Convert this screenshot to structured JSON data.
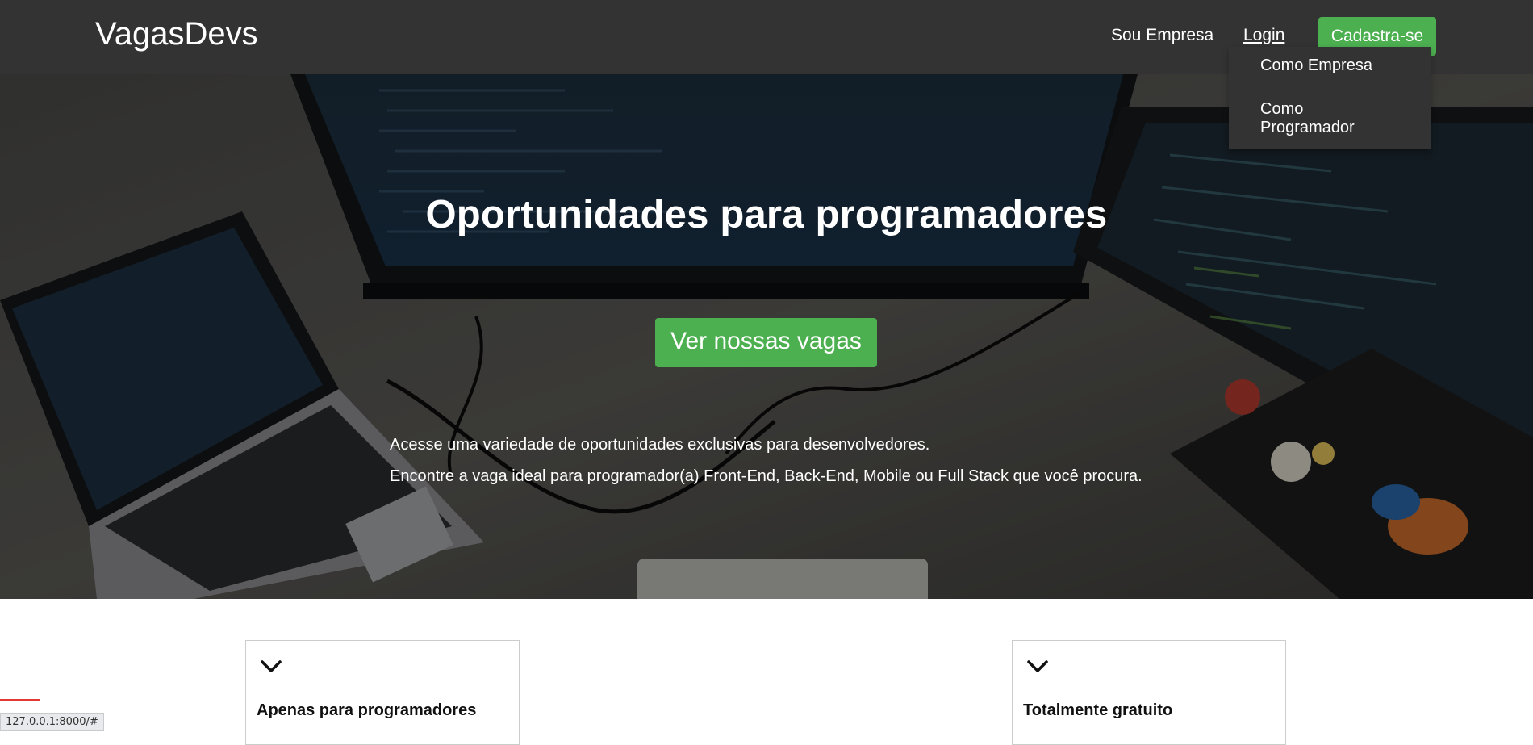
{
  "navbar": {
    "brand": "VagasDevs",
    "company_link": "Sou Empresa",
    "login_link": "Login",
    "signup_button": "Cadastra-se"
  },
  "login_dropdown": {
    "items": [
      "Como Empresa",
      "Como Programador"
    ]
  },
  "hero": {
    "title": "Oportunidades para programadores",
    "cta_button": "Ver nossas vagas",
    "text_1": "Acesse uma variedade de oportunidades exclusivas para desenvolvedores.",
    "text_2": "Encontre a vaga ideal para programador(a) Front-End, Back-End, Mobile ou Full Stack que você procura."
  },
  "features": [
    {
      "title": "Apenas para programadores",
      "icon": "chevron-down-icon"
    },
    {
      "title": "Totalmente gratuito",
      "icon": "chevron-down-icon"
    }
  ],
  "status_bar": {
    "url": "127.0.0.1:8000/#"
  },
  "colors": {
    "navbar_bg": "#333333",
    "accent_green": "#4caf50",
    "text_light": "#ffffff"
  }
}
